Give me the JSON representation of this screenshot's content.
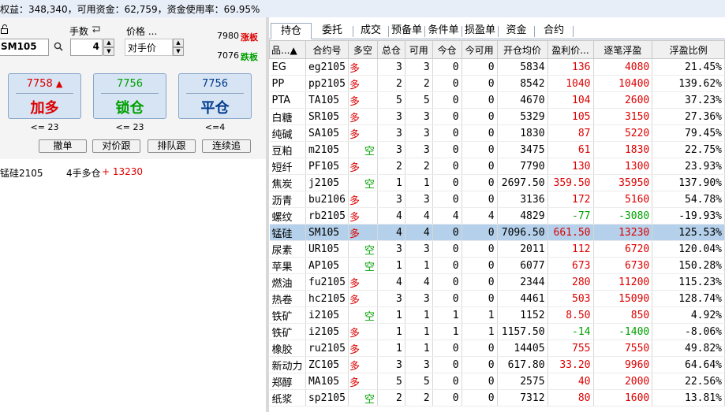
{
  "account_bar": {
    "text": "权益：348,340，可用资金：62,759，资金使用率：69.95%"
  },
  "order_panel": {
    "lock_icon": "lock-icon",
    "contract_value": "SM105",
    "search_icon": "search-icon",
    "lots_label": "手数",
    "lots_icon": "return-arrow-icon",
    "lots_value": "4",
    "price_label": "价格 ...",
    "price_value": "对手价",
    "limit_up_price": "7980",
    "limit_up_label": "涨板",
    "limit_down_price": "7076",
    "limit_down_label": "跌板",
    "buttons": [
      {
        "price": "7758",
        "arrow": "▲",
        "label": "加多",
        "limit": "<= 23",
        "color": "#dd0000"
      },
      {
        "price": "7756",
        "arrow": "",
        "label": "锁仓",
        "limit": "<= 23",
        "color": "#00a000"
      },
      {
        "price": "7756",
        "arrow": "",
        "label": "平仓",
        "limit": "<=4",
        "color": "#003a8c"
      }
    ],
    "small_buttons": [
      "撤单",
      "对价跟",
      "排队跟",
      "连续追"
    ],
    "position_name": "锰硅2105",
    "position_desc": "4手多仓",
    "position_profit": "+ 13230",
    "colors": {
      "up": "#dd0000",
      "down": "#00a000",
      "pale_button": "#d6e4f4",
      "selected_row": "#b4d0ea"
    }
  },
  "tabs": [
    "持仓",
    "委托",
    "成交",
    "预备单",
    "条件单",
    "损盈单",
    "资金",
    "合约"
  ],
  "table": {
    "headers": [
      "品...▲",
      "合约号",
      "多空",
      "总仓",
      "可用",
      "今仓",
      "今可用",
      "开仓均价",
      "盈利价...",
      "逐笔浮盈",
      "浮盈比例"
    ],
    "rows": [
      {
        "name": "EG",
        "code": "eg2105",
        "dir": "多",
        "total": "3",
        "avail": "3",
        "today": "0",
        "today_avail": "0",
        "open_avg": "5834",
        "profit_price": "136",
        "float_pl": "4080",
        "ratio": "21.45%"
      },
      {
        "name": "PP",
        "code": "pp2105",
        "dir": "多",
        "total": "2",
        "avail": "2",
        "today": "0",
        "today_avail": "0",
        "open_avg": "8542",
        "profit_price": "1040",
        "float_pl": "10400",
        "ratio": "139.62%"
      },
      {
        "name": "PTA",
        "code": "TA105",
        "dir": "多",
        "total": "5",
        "avail": "5",
        "today": "0",
        "today_avail": "0",
        "open_avg": "4670",
        "profit_price": "104",
        "float_pl": "2600",
        "ratio": "37.23%"
      },
      {
        "name": "白糖",
        "code": "SR105",
        "dir": "多",
        "total": "3",
        "avail": "3",
        "today": "0",
        "today_avail": "0",
        "open_avg": "5329",
        "profit_price": "105",
        "float_pl": "3150",
        "ratio": "27.36%"
      },
      {
        "name": "纯碱",
        "code": "SA105",
        "dir": "多",
        "total": "3",
        "avail": "3",
        "today": "0",
        "today_avail": "0",
        "open_avg": "1830",
        "profit_price": "87",
        "float_pl": "5220",
        "ratio": "79.45%"
      },
      {
        "name": "豆粕",
        "code": "m2105",
        "dir": "空",
        "total": "3",
        "avail": "3",
        "today": "0",
        "today_avail": "0",
        "open_avg": "3475",
        "profit_price": "61",
        "float_pl": "1830",
        "ratio": "22.75%"
      },
      {
        "name": "短纤",
        "code": "PF105",
        "dir": "多",
        "total": "2",
        "avail": "2",
        "today": "0",
        "today_avail": "0",
        "open_avg": "7790",
        "profit_price": "130",
        "float_pl": "1300",
        "ratio": "23.93%"
      },
      {
        "name": "焦炭",
        "code": "j2105",
        "dir": "空",
        "total": "1",
        "avail": "1",
        "today": "0",
        "today_avail": "0",
        "open_avg": "2697.50",
        "profit_price": "359.50",
        "float_pl": "35950",
        "ratio": "137.90%"
      },
      {
        "name": "沥青",
        "code": "bu2106",
        "dir": "多",
        "total": "3",
        "avail": "3",
        "today": "0",
        "today_avail": "0",
        "open_avg": "3136",
        "profit_price": "172",
        "float_pl": "5160",
        "ratio": "54.78%"
      },
      {
        "name": "螺纹",
        "code": "rb2105",
        "dir": "多",
        "total": "4",
        "avail": "4",
        "today": "4",
        "today_avail": "4",
        "open_avg": "4829",
        "profit_price": "-77",
        "float_pl": "-3080",
        "ratio": "-19.93%"
      },
      {
        "name": "锰硅",
        "code": "SM105",
        "dir": "多",
        "total": "4",
        "avail": "4",
        "today": "0",
        "today_avail": "0",
        "open_avg": "7096.50",
        "profit_price": "661.50",
        "float_pl": "13230",
        "ratio": "125.53%"
      },
      {
        "name": "尿素",
        "code": "UR105",
        "dir": "空",
        "total": "3",
        "avail": "3",
        "today": "0",
        "today_avail": "0",
        "open_avg": "2011",
        "profit_price": "112",
        "float_pl": "6720",
        "ratio": "120.04%"
      },
      {
        "name": "苹果",
        "code": "AP105",
        "dir": "空",
        "total": "1",
        "avail": "1",
        "today": "0",
        "today_avail": "0",
        "open_avg": "6077",
        "profit_price": "673",
        "float_pl": "6730",
        "ratio": "150.28%"
      },
      {
        "name": "燃油",
        "code": "fu2105",
        "dir": "多",
        "total": "4",
        "avail": "4",
        "today": "0",
        "today_avail": "0",
        "open_avg": "2344",
        "profit_price": "280",
        "float_pl": "11200",
        "ratio": "115.23%"
      },
      {
        "name": "热卷",
        "code": "hc2105",
        "dir": "多",
        "total": "3",
        "avail": "3",
        "today": "0",
        "today_avail": "0",
        "open_avg": "4461",
        "profit_price": "503",
        "float_pl": "15090",
        "ratio": "128.74%"
      },
      {
        "name": "铁矿",
        "code": "i2105",
        "dir": "空",
        "total": "1",
        "avail": "1",
        "today": "1",
        "today_avail": "1",
        "open_avg": "1152",
        "profit_price": "8.50",
        "float_pl": "850",
        "ratio": "4.92%"
      },
      {
        "name": "铁矿",
        "code": "i2105",
        "dir": "多",
        "total": "1",
        "avail": "1",
        "today": "1",
        "today_avail": "1",
        "open_avg": "1157.50",
        "profit_price": "-14",
        "float_pl": "-1400",
        "ratio": "-8.06%"
      },
      {
        "name": "橡胶",
        "code": "ru2105",
        "dir": "多",
        "total": "1",
        "avail": "1",
        "today": "0",
        "today_avail": "0",
        "open_avg": "14405",
        "profit_price": "755",
        "float_pl": "7550",
        "ratio": "49.82%"
      },
      {
        "name": "新动力",
        "code": "ZC105",
        "dir": "多",
        "total": "3",
        "avail": "3",
        "today": "0",
        "today_avail": "0",
        "open_avg": "617.80",
        "profit_price": "33.20",
        "float_pl": "9960",
        "ratio": "64.64%"
      },
      {
        "name": "郑醇",
        "code": "MA105",
        "dir": "多",
        "total": "5",
        "avail": "5",
        "today": "0",
        "today_avail": "0",
        "open_avg": "2575",
        "profit_price": "40",
        "float_pl": "2000",
        "ratio": "22.56%"
      },
      {
        "name": "纸浆",
        "code": "sp2105",
        "dir": "空",
        "total": "2",
        "avail": "2",
        "today": "0",
        "today_avail": "0",
        "open_avg": "7312",
        "profit_price": "80",
        "float_pl": "1600",
        "ratio": "13.81%"
      }
    ]
  }
}
